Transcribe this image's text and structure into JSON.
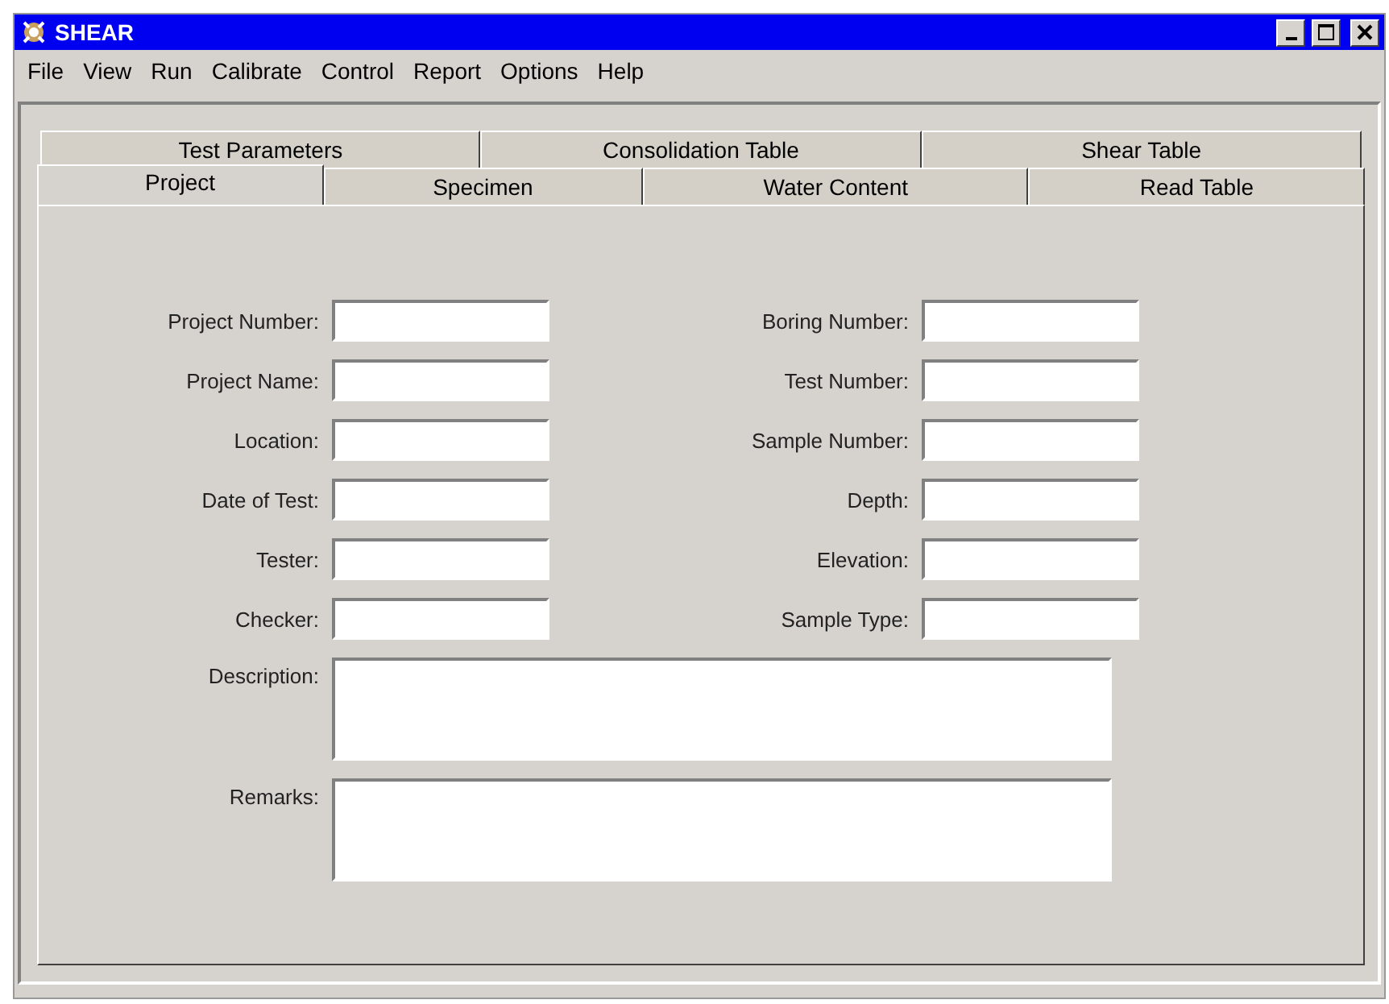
{
  "window": {
    "title": "SHEAR"
  },
  "menu": [
    "File",
    "View",
    "Run",
    "Calibrate",
    "Control",
    "Report",
    "Options",
    "Help"
  ],
  "tab_rows": [
    [
      {
        "label": "Test Parameters",
        "selected": false
      },
      {
        "label": "Consolidation Table",
        "selected": false
      },
      {
        "label": "Shear Table",
        "selected": false
      }
    ],
    [
      {
        "label": "Project",
        "selected": true
      },
      {
        "label": "Specimen",
        "selected": false
      },
      {
        "label": "Water Content",
        "selected": false
      },
      {
        "label": "Read Table",
        "selected": false
      }
    ]
  ],
  "fields_left": [
    {
      "label": "Project Number:"
    },
    {
      "label": "Project Name:"
    },
    {
      "label": "Location:"
    },
    {
      "label": "Date of Test:"
    },
    {
      "label": "Tester:"
    },
    {
      "label": "Checker:"
    }
  ],
  "fields_right": [
    {
      "label": "Boring Number:"
    },
    {
      "label": "Test Number:"
    },
    {
      "label": "Sample Number:"
    },
    {
      "label": "Depth:"
    },
    {
      "label": "Elevation:"
    },
    {
      "label": "Sample Type:"
    }
  ],
  "text_areas": [
    {
      "label": "Description:"
    },
    {
      "label": "Remarks:"
    }
  ]
}
